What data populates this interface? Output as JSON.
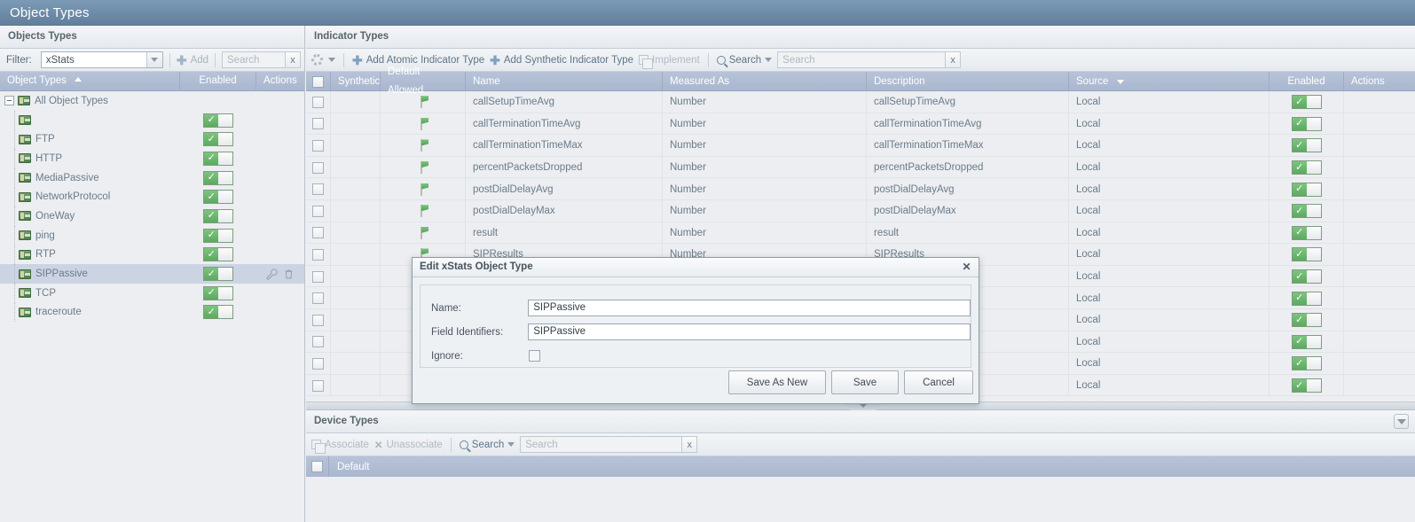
{
  "titlebar": {
    "title": "Object Types"
  },
  "left_panel": {
    "header": "Objects Types",
    "filter": {
      "label": "Filter:",
      "value": "xStats",
      "add_label": "Add",
      "search_placeholder": "Search",
      "clear_label": "x"
    },
    "columns": [
      {
        "label": "Object Types",
        "sort": "asc"
      },
      {
        "label": "Enabled",
        "sort": ""
      },
      {
        "label": "Actions",
        "sort": ""
      }
    ],
    "root": "All Object Types",
    "items": [
      {
        "label": "",
        "enabled": true,
        "selected": false
      },
      {
        "label": "FTP",
        "enabled": true,
        "selected": false
      },
      {
        "label": "HTTP",
        "enabled": true,
        "selected": false
      },
      {
        "label": "MediaPassive",
        "enabled": true,
        "selected": false
      },
      {
        "label": "NetworkProtocol",
        "enabled": true,
        "selected": false
      },
      {
        "label": "OneWay",
        "enabled": true,
        "selected": false
      },
      {
        "label": "ping",
        "enabled": true,
        "selected": false
      },
      {
        "label": "RTP",
        "enabled": true,
        "selected": false
      },
      {
        "label": "SIPPassive",
        "enabled": true,
        "selected": true
      },
      {
        "label": "TCP",
        "enabled": true,
        "selected": false
      },
      {
        "label": "traceroute",
        "enabled": true,
        "selected": false
      }
    ]
  },
  "indicator_types": {
    "header": "Indicator Types",
    "toolbar": {
      "add_atomic_label": "Add Atomic Indicator Type",
      "add_synthetic_label": "Add Synthetic Indicator Type",
      "implement_label": "Implement",
      "search_label": "Search",
      "search_placeholder": "Search",
      "clear_label": "x"
    },
    "columns": [
      {
        "label": "",
        "key": "check"
      },
      {
        "label": "Synthetic",
        "key": "synthetic"
      },
      {
        "label": "Default Allowed",
        "key": "default_allowed"
      },
      {
        "label": "Name",
        "key": "name"
      },
      {
        "label": "Measured As",
        "key": "measured_as"
      },
      {
        "label": "Description",
        "key": "description"
      },
      {
        "label": "Source",
        "key": "source",
        "sort": "desc"
      },
      {
        "label": "Enabled",
        "key": "enabled"
      },
      {
        "label": "Actions",
        "key": "actions"
      }
    ],
    "rows": [
      {
        "name": "callSetupTimeAvg",
        "measured_as": "Number",
        "description": "callSetupTimeAvg",
        "source": "Local",
        "default_allowed": true,
        "enabled": true
      },
      {
        "name": "callTerminationTimeAvg",
        "measured_as": "Number",
        "description": "callTerminationTimeAvg",
        "source": "Local",
        "default_allowed": true,
        "enabled": true
      },
      {
        "name": "callTerminationTimeMax",
        "measured_as": "Number",
        "description": "callTerminationTimeMax",
        "source": "Local",
        "default_allowed": true,
        "enabled": true
      },
      {
        "name": "percentPacketsDropped",
        "measured_as": "Number",
        "description": "percentPacketsDropped",
        "source": "Local",
        "default_allowed": true,
        "enabled": true
      },
      {
        "name": "postDialDelayAvg",
        "measured_as": "Number",
        "description": "postDialDelayAvg",
        "source": "Local",
        "default_allowed": true,
        "enabled": true
      },
      {
        "name": "postDialDelayMax",
        "measured_as": "Number",
        "description": "postDialDelayMax",
        "source": "Local",
        "default_allowed": true,
        "enabled": true
      },
      {
        "name": "result",
        "measured_as": "Number",
        "description": "result",
        "source": "Local",
        "default_allowed": true,
        "enabled": true
      },
      {
        "name": "SIPResults",
        "measured_as": "Number",
        "description": "SIPResults",
        "source": "Local",
        "default_allowed": true,
        "enabled": true
      },
      {
        "name": "",
        "measured_as": "",
        "description": "",
        "source": "Local",
        "default_allowed": false,
        "enabled": true
      },
      {
        "name": "",
        "measured_as": "",
        "description": "",
        "source": "Local",
        "default_allowed": false,
        "enabled": true
      },
      {
        "name": "",
        "measured_as": "",
        "description": "",
        "source": "Local",
        "default_allowed": false,
        "enabled": true
      },
      {
        "name": "",
        "measured_as": "",
        "description": "",
        "source": "Local",
        "default_allowed": false,
        "enabled": true
      },
      {
        "name": "",
        "measured_as": "",
        "description": "",
        "source": "Local",
        "default_allowed": false,
        "enabled": true
      },
      {
        "name": "",
        "measured_as": "",
        "description": "",
        "source": "Local",
        "default_allowed": false,
        "enabled": true
      }
    ]
  },
  "device_types": {
    "header": "Device Types",
    "toolbar": {
      "associate_label": "Associate",
      "unassociate_label": "Unassociate",
      "search_label": "Search",
      "search_placeholder": "Search",
      "clear_label": "x"
    },
    "rows": [
      {
        "label": "Default"
      }
    ]
  },
  "dialog": {
    "title": "Edit xStats Object Type",
    "close_label": "✕",
    "fields": {
      "name_label": "Name:",
      "name_value": "SIPPassive",
      "field_identifiers_label": "Field Identifiers:",
      "field_identifiers_value": "SIPPassive",
      "ignore_label": "Ignore:",
      "ignore_checked": false
    },
    "buttons": {
      "save_as_new": "Save As New",
      "save": "Save",
      "cancel": "Cancel"
    }
  },
  "colors": {
    "title_bar": "#6e8da9",
    "grid_header": "#aebbd2",
    "toggle_on": "#5daa60",
    "panel_bg": "#eceef1"
  }
}
